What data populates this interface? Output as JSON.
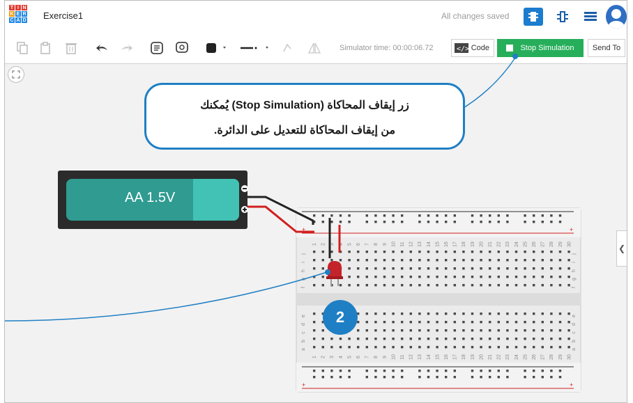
{
  "app": {
    "logo_letters": [
      "T",
      "I",
      "N",
      "K",
      "E",
      "R",
      "C",
      "A",
      "D"
    ],
    "document_title": "Exercise1",
    "save_status": "All changes saved"
  },
  "toolbar": {
    "simulator_time": "Simulator time: 00:00:06.72",
    "code_label": "Code",
    "stop_label": "Stop Simulation",
    "send_label": "Send To"
  },
  "callout": {
    "line1": "زر إيقاف المحاكاة (Stop Simulation) يُمكنك",
    "line2": "من إيقاف المحاكاة للتعديل على الدائرة."
  },
  "battery": {
    "label": "AA 1.5V"
  },
  "badge": {
    "number": "2"
  },
  "breadboard": {
    "columns": [
      "1",
      "2",
      "3",
      "4",
      "5",
      "6",
      "7",
      "8",
      "9",
      "10",
      "11",
      "12",
      "13",
      "14",
      "15",
      "16",
      "17",
      "18",
      "19",
      "20",
      "21",
      "22",
      "23",
      "24",
      "25",
      "26",
      "27",
      "28",
      "29",
      "30"
    ],
    "rows_top": [
      "j",
      "i",
      "h",
      "g",
      "f"
    ],
    "rows_bottom": [
      "e",
      "d",
      "c",
      "b",
      "a"
    ]
  },
  "colors": {
    "accent": "#1f7fc4",
    "stop_button": "#26ae5a",
    "battery_body": "#2f9b91",
    "led": "#c4232a",
    "wire_red": "#d11f1f",
    "wire_black": "#222222"
  }
}
